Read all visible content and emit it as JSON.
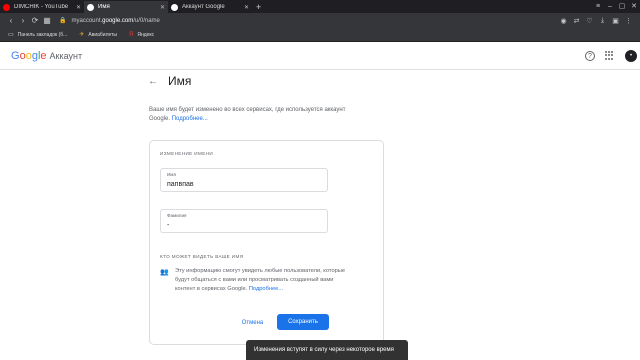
{
  "browser": {
    "tabs": [
      {
        "label": "DIMCHIK - YouTube",
        "favicon_color": "#ff0000"
      },
      {
        "label": "Имя",
        "favicon_color": "#ffffff"
      },
      {
        "label": "Аккаунт Google",
        "favicon_color": "#ffffff"
      }
    ],
    "url_path_prefix": "myaccount.",
    "url_domain": "google.com",
    "url_path": "/u/0/name",
    "bookmarks": [
      {
        "label": "Панель закладок (б...",
        "icon": "folder-icon"
      },
      {
        "label": "Авиабилеты",
        "icon": "plane-icon"
      },
      {
        "label": "Яндекс",
        "icon": "yandex-icon"
      }
    ]
  },
  "header": {
    "logo_text": "Google",
    "product": "Аккаунт",
    "avatar_letter": "•"
  },
  "page": {
    "title": "Имя",
    "description": "Ваше имя будет изменено во всех сервисах, где используется аккаунт Google.",
    "more_link": "Подробнее..."
  },
  "form": {
    "section_title": "ИЗМЕНЕНИЕ ИМЕНИ",
    "first_name_label": "Имя",
    "first_name_value": "папвпав",
    "last_name_label": "Фамилия",
    "last_name_value": "-",
    "visibility_title": "КТО МОЖЕТ ВИДЕТЬ ВАШЕ ИМЯ",
    "visibility_text": "Эту информацию смогут увидеть любые пользователи, которые будут общаться с вами или просматривать созданный вами контент в сервисах Google.",
    "visibility_link": "Подробнее...",
    "cancel_label": "Отмена",
    "save_label": "Сохранить"
  },
  "toast": {
    "message": "Изменения вступят в силу через некоторое время"
  },
  "colors": {
    "accent": "#1a73e8",
    "toast_bg": "#323232"
  }
}
